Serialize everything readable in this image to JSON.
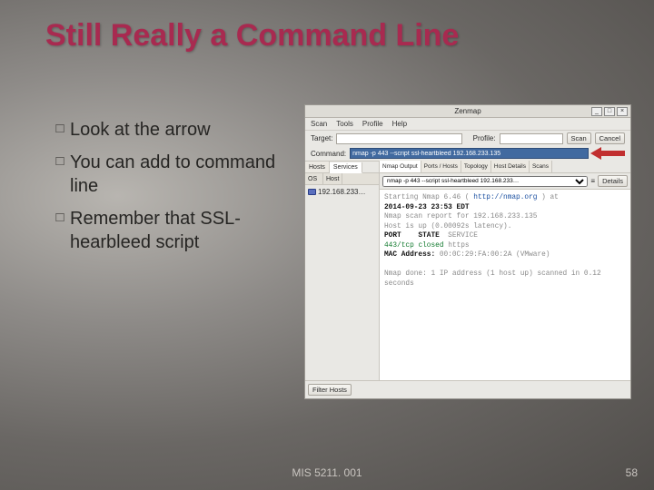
{
  "slide": {
    "title": "Still Really a Command Line",
    "bullets": [
      "Look at the arrow",
      "You can add to command line",
      "Remember that SSL-hearbleed script"
    ],
    "footer_mid": "MIS 5211. 001",
    "page_number": "58"
  },
  "zenmap": {
    "window_title": "Zenmap",
    "win_buttons": {
      "min": "_",
      "max": "□",
      "close": "×"
    },
    "menu": [
      "Scan",
      "Tools",
      "Profile",
      "Help"
    ],
    "target_label": "Target:",
    "target_value": "",
    "profile_label": "Profile:",
    "profile_value": "",
    "scan_btn": "Scan",
    "cancel_btn": "Cancel",
    "command_label": "Command:",
    "command_value": "nmap -p 443 --script ssl-heartbleed 192.168.233.135",
    "side_tabs": {
      "hosts": "Hosts",
      "services": "Services"
    },
    "side_cols": {
      "os": "OS",
      "host": "Host"
    },
    "host_ip": "192.168.233…",
    "main_tabs": [
      "Nmap Output",
      "Ports / Hosts",
      "Topology",
      "Host Details",
      "Scans"
    ],
    "output_selector": "nmap -p 443 --script ssl-heartbleed 192.168.233…",
    "details_btn": "Details",
    "output": {
      "l1a": "Starting Nmap 6.46 ( ",
      "l1b": "http://nmap.org",
      "l1c": " ) at",
      "l2": "2014-09-23 23:53 EDT",
      "l3": "Nmap scan report for 192.168.233.135",
      "l4": "Host is up (0.00092s latency).",
      "l5a": "PORT    STATE",
      "l5b": "  SERVICE",
      "l6a": "443/tcp ",
      "l6b": "closed",
      "l6c": " https",
      "l7a": "MAC Address:",
      "l7b": " 00:0C:29:FA:00:2A (VMware)",
      "l8": "Nmap done: 1 IP address (1 host up) scanned in 0.12 seconds"
    },
    "filter_btn": "Filter Hosts"
  }
}
